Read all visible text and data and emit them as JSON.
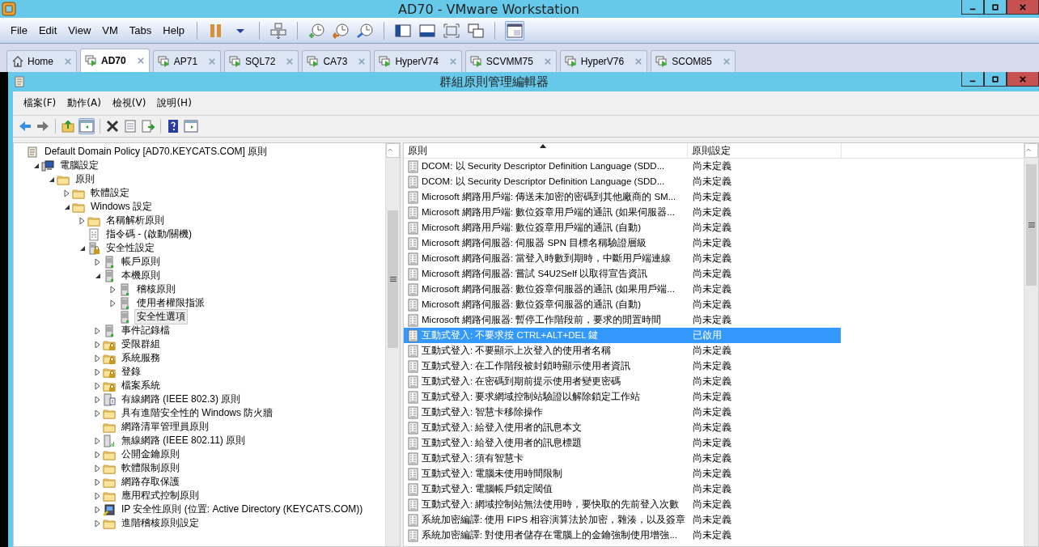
{
  "window": {
    "title": "AD70 - VMware Workstation"
  },
  "menu": [
    "File",
    "Edit",
    "View",
    "VM",
    "Tabs",
    "Help"
  ],
  "tabs": [
    {
      "label": "Home",
      "kind": "home",
      "selected": false
    },
    {
      "label": "AD70",
      "kind": "vm",
      "selected": true
    },
    {
      "label": "AP71",
      "kind": "vm",
      "selected": false
    },
    {
      "label": "SQL72",
      "kind": "vm",
      "selected": false
    },
    {
      "label": "CA73",
      "kind": "vm",
      "selected": false
    },
    {
      "label": "HyperV74",
      "kind": "vm",
      "selected": false
    },
    {
      "label": "SCVMM75",
      "kind": "vm",
      "selected": false
    },
    {
      "label": "HyperV76",
      "kind": "vm",
      "selected": false
    },
    {
      "label": "SCOM85",
      "kind": "vm",
      "selected": false
    }
  ],
  "editor": {
    "title": "群組原則管理編輯器",
    "menu": [
      "檔案(F)",
      "動作(A)",
      "檢視(V)",
      "說明(H)"
    ],
    "tree": [
      {
        "label": "Default Domain Policy [AD70.KEYCATS.COM] 原則",
        "kind": "scroll",
        "selected": false,
        "children": [
          {
            "label": "電腦設定",
            "kind": "computer",
            "expanded": true,
            "selected": false,
            "children": [
              {
                "label": "原則",
                "kind": "folder",
                "expanded": true,
                "selected": false,
                "children": [
                  {
                    "label": "軟體設定",
                    "kind": "folder",
                    "expanded": false,
                    "selected": false
                  },
                  {
                    "label": "Windows 設定",
                    "kind": "folder",
                    "expanded": true,
                    "selected": false,
                    "children": [
                      {
                        "label": "名稱解析原則",
                        "kind": "folder",
                        "expanded": false,
                        "selected": false
                      },
                      {
                        "label": "指令碼 - (啟動/關機)",
                        "kind": "script",
                        "selected": false
                      },
                      {
                        "label": "安全性設定",
                        "kind": "seclock",
                        "expanded": true,
                        "selected": false,
                        "children": [
                          {
                            "label": "帳戶原則",
                            "kind": "server",
                            "expanded": false,
                            "selected": false
                          },
                          {
                            "label": "本機原則",
                            "kind": "server",
                            "expanded": true,
                            "selected": false,
                            "children": [
                              {
                                "label": "稽核原則",
                                "kind": "server",
                                "expanded": false,
                                "selected": false
                              },
                              {
                                "label": "使用者權限指派",
                                "kind": "server",
                                "expanded": false,
                                "selected": false
                              },
                              {
                                "label": "安全性選項",
                                "kind": "server",
                                "selected": true
                              }
                            ]
                          },
                          {
                            "label": "事件記錄檔",
                            "kind": "server",
                            "expanded": false,
                            "selected": false
                          },
                          {
                            "label": "受限群組",
                            "kind": "folderlock",
                            "expanded": false,
                            "selected": false
                          },
                          {
                            "label": "系統服務",
                            "kind": "folderlock",
                            "expanded": false,
                            "selected": false
                          },
                          {
                            "label": "登錄",
                            "kind": "folderlock",
                            "expanded": false,
                            "selected": false
                          },
                          {
                            "label": "檔案系統",
                            "kind": "folderlock",
                            "expanded": false,
                            "selected": false
                          },
                          {
                            "label": "有線網路 (IEEE 802.3) 原則",
                            "kind": "wired",
                            "expanded": false,
                            "selected": false
                          },
                          {
                            "label": "具有進階安全性的 Windows 防火牆",
                            "kind": "folder",
                            "expanded": false,
                            "selected": false
                          },
                          {
                            "label": "網路清單管理員原則",
                            "kind": "folder",
                            "selected": false
                          },
                          {
                            "label": "無線網路 (IEEE 802.11) 原則",
                            "kind": "wireless",
                            "expanded": false,
                            "selected": false
                          },
                          {
                            "label": "公開金鑰原則",
                            "kind": "folder",
                            "expanded": false,
                            "selected": false
                          },
                          {
                            "label": "軟體限制原則",
                            "kind": "folder",
                            "expanded": false,
                            "selected": false
                          },
                          {
                            "label": "網路存取保護",
                            "kind": "folder",
                            "expanded": false,
                            "selected": false
                          },
                          {
                            "label": "應用程式控制原則",
                            "kind": "folder",
                            "expanded": false,
                            "selected": false
                          },
                          {
                            "label": "IP 安全性原則 (位置: Active Directory (KEYCATS.COM))",
                            "kind": "ipsec",
                            "expanded": false,
                            "selected": false
                          },
                          {
                            "label": "進階稽核原則設定",
                            "kind": "folder",
                            "expanded": false,
                            "selected": false
                          }
                        ]
                      }
                    ]
                  }
                ]
              }
            ]
          }
        ]
      }
    ],
    "columns": [
      "原則",
      "原則設定"
    ],
    "rows": [
      {
        "policy": "DCOM: 以 Security Descriptor Definition Language (SDD...",
        "setting": "尚未定義",
        "selected": false
      },
      {
        "policy": "DCOM: 以 Security Descriptor Definition Language (SDD...",
        "setting": "尚未定義",
        "selected": false
      },
      {
        "policy": "Microsoft 網路用戶端: 傳送未加密的密碼到其他廠商的 SM...",
        "setting": "尚未定義",
        "selected": false
      },
      {
        "policy": "Microsoft 網路用戶端: 數位簽章用戶端的通訊 (如果伺服器...",
        "setting": "尚未定義",
        "selected": false
      },
      {
        "policy": "Microsoft 網路用戶端: 數位簽章用戶端的通訊 (自動)",
        "setting": "尚未定義",
        "selected": false
      },
      {
        "policy": "Microsoft 網路伺服器: 伺服器 SPN 目標名稱驗證層級",
        "setting": "尚未定義",
        "selected": false
      },
      {
        "policy": "Microsoft 網路伺服器: 當登入時數到期時，中斷用戶端連線",
        "setting": "尚未定義",
        "selected": false
      },
      {
        "policy": "Microsoft 網路伺服器: 嘗試 S4U2Self 以取得宣告資訊",
        "setting": "尚未定義",
        "selected": false
      },
      {
        "policy": "Microsoft 網路伺服器: 數位簽章伺服器的通訊 (如果用戶端...",
        "setting": "尚未定義",
        "selected": false
      },
      {
        "policy": "Microsoft 網路伺服器: 數位簽章伺服器的通訊 (自動)",
        "setting": "尚未定義",
        "selected": false
      },
      {
        "policy": "Microsoft 網路伺服器: 暫停工作階段前，要求的閒置時間",
        "setting": "尚未定義",
        "selected": false
      },
      {
        "policy": "互動式登入: 不要求按 CTRL+ALT+DEL 鍵",
        "setting": "已啟用",
        "selected": true
      },
      {
        "policy": "互動式登入: 不要顯示上次登入的使用者名稱",
        "setting": "尚未定義",
        "selected": false
      },
      {
        "policy": "互動式登入: 在工作階段被封鎖時顯示使用者資訊",
        "setting": "尚未定義",
        "selected": false
      },
      {
        "policy": "互動式登入: 在密碼到期前提示使用者變更密碼",
        "setting": "尚未定義",
        "selected": false
      },
      {
        "policy": "互動式登入: 要求網域控制站驗證以解除鎖定工作站",
        "setting": "尚未定義",
        "selected": false
      },
      {
        "policy": "互動式登入: 智慧卡移除操作",
        "setting": "尚未定義",
        "selected": false
      },
      {
        "policy": "互動式登入: 給登入使用者的訊息本文",
        "setting": "尚未定義",
        "selected": false
      },
      {
        "policy": "互動式登入: 給登入使用者的訊息標題",
        "setting": "尚未定義",
        "selected": false
      },
      {
        "policy": "互動式登入: 須有智慧卡",
        "setting": "尚未定義",
        "selected": false
      },
      {
        "policy": "互動式登入: 電腦未使用時間限制",
        "setting": "尚未定義",
        "selected": false
      },
      {
        "policy": "互動式登入: 電腦帳戶鎖定閾值",
        "setting": "尚未定義",
        "selected": false
      },
      {
        "policy": "互動式登入: 網域控制站無法使用時，要快取的先前登入次數",
        "setting": "尚未定義",
        "selected": false
      },
      {
        "policy": "系統加密編譯: 使用 FIPS 相容演算法於加密，雜湊，以及簽章",
        "setting": "尚未定義",
        "selected": false
      },
      {
        "policy": "系統加密編譯: 對使用者儲存在電腦上的金鑰強制使用增強...",
        "setting": "尚未定義",
        "selected": false
      }
    ]
  }
}
